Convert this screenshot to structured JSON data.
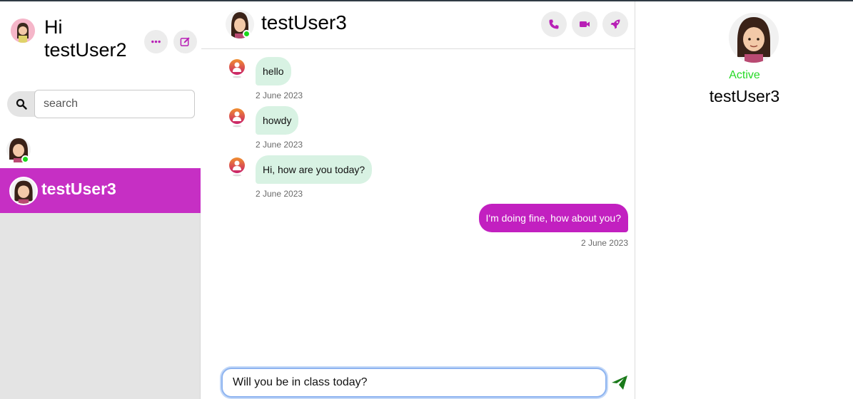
{
  "sidebar": {
    "greeting": "Hi testUser2",
    "search_placeholder": "search",
    "contacts": [
      {
        "name": "",
        "online": true
      },
      {
        "name": "testUser3",
        "active": true
      }
    ]
  },
  "chat": {
    "contact_name": "testUser3",
    "messages": [
      {
        "direction": "in",
        "text": "hello",
        "time": "2 June 2023"
      },
      {
        "direction": "in",
        "text": "howdy",
        "time": "2 June 2023"
      },
      {
        "direction": "in",
        "text": "Hi, how are you today?",
        "time": "2 June 2023"
      },
      {
        "direction": "out",
        "text": "I'm doing fine, how about you?",
        "time": "2 June 2023"
      }
    ],
    "composer_value": "Will you be in class today?"
  },
  "profile": {
    "status": "Active",
    "name": "testUser3"
  },
  "colors": {
    "accent": "#c62fc4",
    "incoming_bubble": "#d8f2e3",
    "online": "#1bd81b",
    "send": "#1a7a1a"
  }
}
